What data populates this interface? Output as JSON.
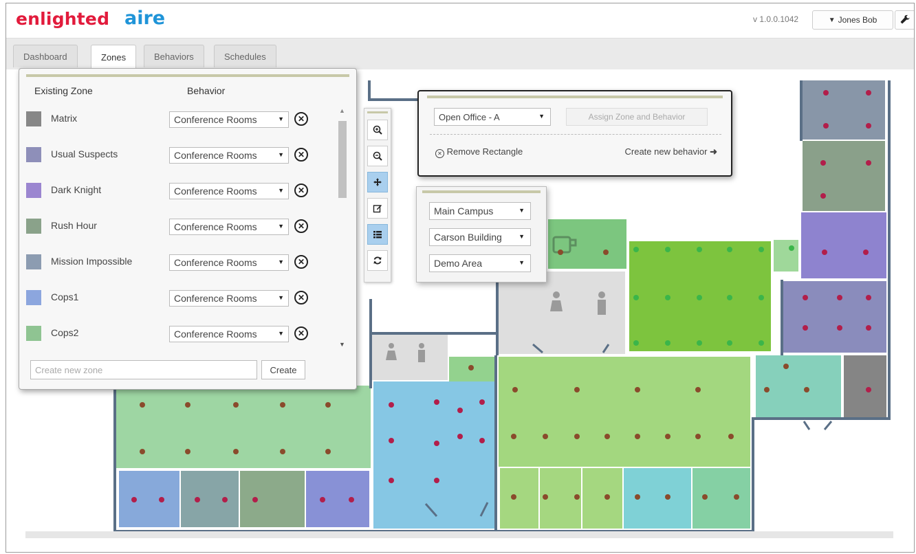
{
  "header": {
    "brand": "enlighted",
    "product": "aire",
    "version": "v 1.0.0.1042",
    "user": "Jones Bob",
    "user_caret_icon": "caret-down-icon",
    "settings_icon": "wrench-icon"
  },
  "tabs": [
    {
      "label": "Dashboard"
    },
    {
      "label": "Zones"
    },
    {
      "label": "Behaviors"
    },
    {
      "label": "Schedules"
    }
  ],
  "active_tab": "Zones",
  "zone_panel": {
    "col_zone": "Existing Zone",
    "col_behavior": "Behavior",
    "zones": [
      {
        "name": "Matrix",
        "color": "#878787",
        "behavior": "Conference Rooms"
      },
      {
        "name": "Usual Suspects",
        "color": "#8e8fb9",
        "behavior": "Conference Rooms"
      },
      {
        "name": "Dark Knight",
        "color": "#9b86d0",
        "behavior": "Conference Rooms"
      },
      {
        "name": "Rush Hour",
        "color": "#8aa28a",
        "behavior": "Conference Rooms"
      },
      {
        "name": "Mission Impossible",
        "color": "#8c9cb1",
        "behavior": "Conference Rooms"
      },
      {
        "name": "Cops1",
        "color": "#8ca6de",
        "behavior": "Conference Rooms"
      },
      {
        "name": "Cops2",
        "color": "#8fc492",
        "behavior": "Conference Rooms"
      }
    ],
    "new_zone_placeholder": "Create new zone",
    "create_label": "Create"
  },
  "toolbar": {
    "tools": [
      "zoom-in-icon",
      "zoom-out-icon",
      "move-icon",
      "edit-icon",
      "list-icon",
      "refresh-icon"
    ],
    "active_tools": [
      "move-icon",
      "list-icon"
    ]
  },
  "assign_popup": {
    "zone_select": "Open Office - A",
    "assign_label": "Assign Zone and Behavior",
    "remove_label": "Remove Rectangle",
    "create_behavior_label": "Create new behavior"
  },
  "location_popup": {
    "campus": "Main Campus",
    "building": "Carson Building",
    "area": "Demo Area"
  },
  "colors": {
    "brand_red": "#e21b3c",
    "brand_blue": "#1f94d8",
    "panel_strip": "#c7c8a8",
    "wall": "#5a6f86",
    "sensor_dot": "#8a4b2c",
    "sensor_dot_occupied": "#b21e4a",
    "sensor_dot_active": "#3bb54a"
  }
}
